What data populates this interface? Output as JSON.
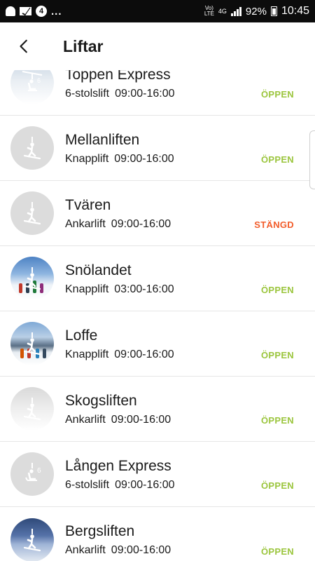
{
  "status_bar": {
    "badge_number": "4",
    "more_indicator": "...",
    "volte_line1": "Vo)",
    "volte_line2": "LTE",
    "network": "4G",
    "battery": "92%",
    "time": "10:45"
  },
  "header": {
    "title": "Liftar"
  },
  "lifts": [
    {
      "name": "Toppen Express",
      "type": "6-stolslift",
      "hours": "09:00-16:00",
      "status": "ÖPPEN",
      "state": "open",
      "icon": "chairlift-6-icon"
    },
    {
      "name": "Mellanliften",
      "type": "Knapplift",
      "hours": "09:00-16:00",
      "status": "ÖPPEN",
      "state": "open",
      "icon": "surface-lift-icon"
    },
    {
      "name": "Tvären",
      "type": "Ankarlift",
      "hours": "09:00-16:00",
      "status": "STÄNGD",
      "state": "closed",
      "icon": "surface-lift-icon"
    },
    {
      "name": "Snölandet",
      "type": "Knapplift",
      "hours": "03:00-16:00",
      "status": "ÖPPEN",
      "state": "open",
      "icon": "surface-lift-icon"
    },
    {
      "name": "Loffe",
      "type": "Knapplift",
      "hours": "09:00-16:00",
      "status": "ÖPPEN",
      "state": "open",
      "icon": "surface-lift-icon"
    },
    {
      "name": "Skogsliften",
      "type": "Ankarlift",
      "hours": "09:00-16:00",
      "status": "ÖPPEN",
      "state": "open",
      "icon": "surface-lift-icon"
    },
    {
      "name": "Lången Express",
      "type": "6-stolslift",
      "hours": "09:00-16:00",
      "status": "ÖPPEN",
      "state": "open",
      "icon": "chairlift-6-icon"
    },
    {
      "name": "Bergsliften",
      "type": "Ankarlift",
      "hours": "09:00-16:00",
      "status": "ÖPPEN",
      "state": "open",
      "icon": "surface-lift-icon"
    }
  ],
  "chairlift_badge": "6",
  "colors": {
    "open": "#9bc53d",
    "closed": "#f25c2a",
    "statusbar": "#0c0c0c",
    "divider": "#e6e6e6"
  }
}
